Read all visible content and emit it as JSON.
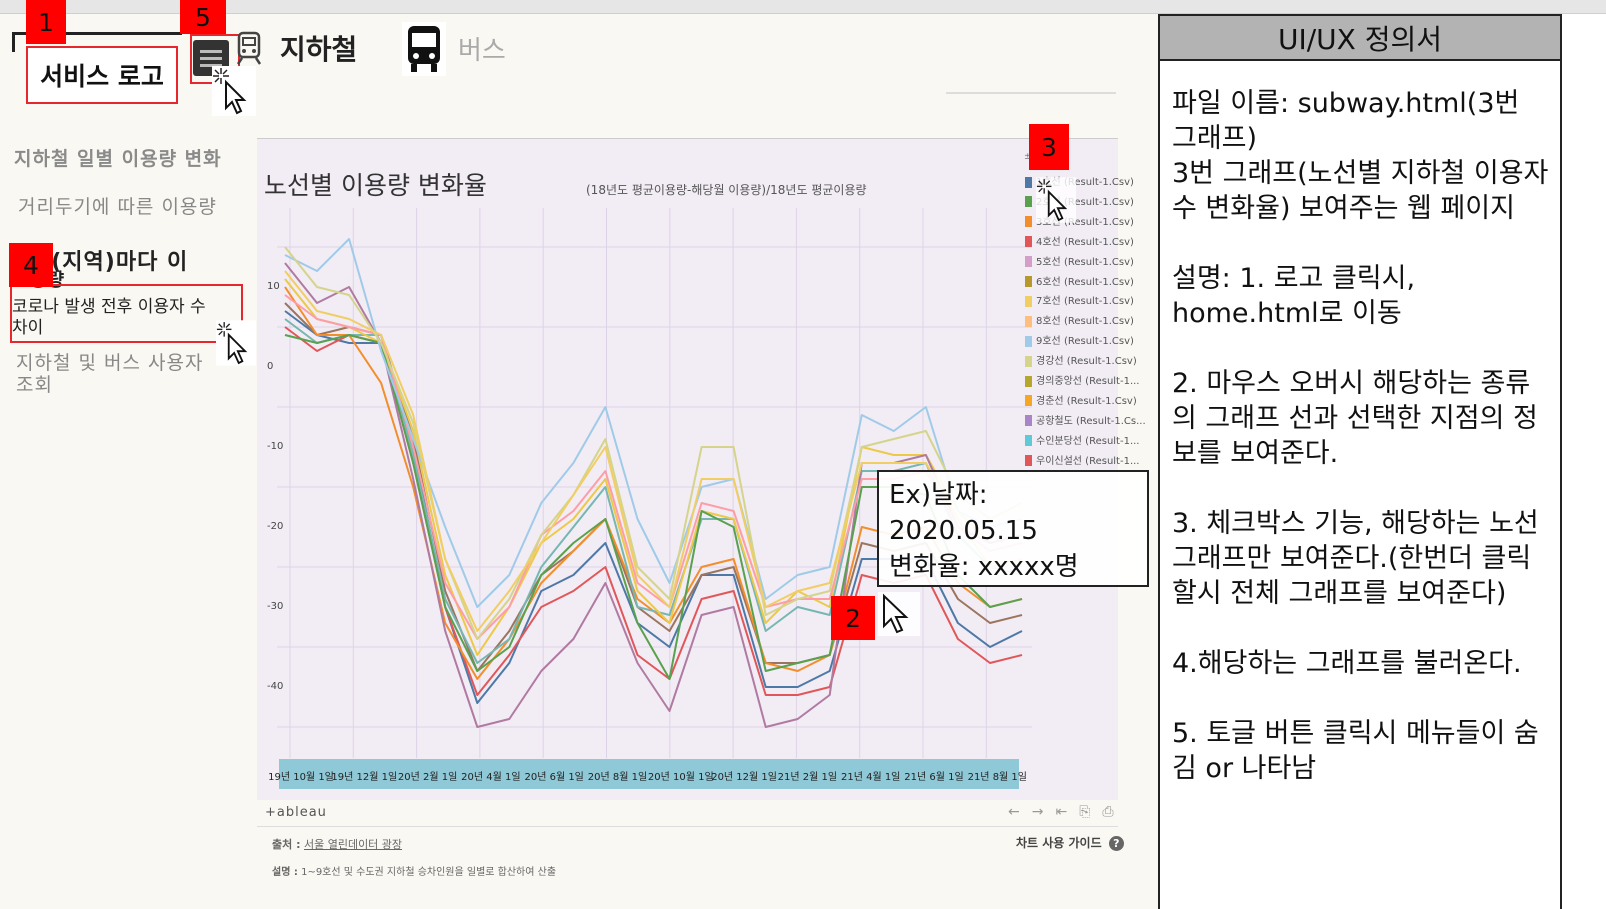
{
  "nav": {
    "logo": "서비스 로고",
    "subway_tab": "지하철",
    "bus_tab": "버스"
  },
  "sidebar": {
    "items": [
      {
        "label": "지하철 일별 이용량 변화"
      },
      {
        "label": "거리두기에 따른 이용량"
      },
      {
        "label": "선(지역)마다 이"
      },
      {
        "label": "코로나 발생 전후 이용자 수 차이"
      },
      {
        "label": "지하철 및 버스 사용자 조회"
      }
    ],
    "overlap_fragment": "용량"
  },
  "markers": [
    "1",
    "2",
    "3",
    "4",
    "5"
  ],
  "chart_data": {
    "type": "line",
    "title": "노선별 이용량 변화율",
    "subtitle": "(18년도 평균이용량-해당월 이용량)/18년도 평균이용량",
    "x_ticks": [
      "19년 10월 1일",
      "19년 12월 1일",
      "20년 2월 1일",
      "20년 4월 1일",
      "20년 6월 1일",
      "20년 8월 1일",
      "20년 10월 1일",
      "20년 12월 1일",
      "21년 2월 1일",
      "21년 4월 1일",
      "21년 6월 1일",
      "21년 8월 1일"
    ],
    "y_ticks": [
      "10",
      "0",
      "-10",
      "-20",
      "-30",
      "-40"
    ],
    "ylim": [
      -50,
      15
    ],
    "x_points": 24,
    "series": [
      {
        "color": "#4e79a7",
        "values": [
          7,
          4,
          3,
          3,
          -10,
          -30,
          -42,
          -37,
          -28,
          -26,
          -22,
          -32,
          -35,
          -26,
          -26,
          -40,
          -40,
          -38,
          -24,
          -24,
          -24,
          -32,
          -35,
          -33
        ]
      },
      {
        "color": "#e15759",
        "values": [
          5,
          2,
          4,
          3,
          -12,
          -30,
          -41,
          -36,
          -30,
          -28,
          -25,
          -36,
          -39,
          -29,
          -28,
          -41,
          -41,
          -40,
          -26,
          -27,
          -26,
          -34,
          -37,
          -36
        ]
      },
      {
        "color": "#9c755f",
        "values": [
          8,
          4,
          5,
          4,
          -9,
          -28,
          -38,
          -33,
          -26,
          -23,
          -19,
          -30,
          -33,
          -26,
          -25,
          -37,
          -37,
          -36,
          -22,
          -23,
          -22,
          -29,
          -32,
          -31
        ]
      },
      {
        "color": "#f28e2b",
        "values": [
          10,
          4,
          4,
          -2,
          -15,
          -32,
          -39,
          -34,
          -27,
          -23,
          -19,
          -29,
          -32,
          -25,
          -24,
          -37,
          -38,
          -36,
          -20,
          -21,
          -20,
          -27,
          -30,
          -29
        ]
      },
      {
        "color": "#76b7b2",
        "values": [
          6,
          3,
          4,
          4,
          -11,
          -29,
          -37,
          -34,
          -25,
          -20,
          -15,
          -30,
          -31,
          -19,
          -19,
          -33,
          -30,
          -31,
          -13,
          -13,
          -12,
          -21,
          -25,
          -26
        ]
      },
      {
        "color": "#edc948",
        "values": [
          11,
          6,
          5,
          3,
          -8,
          -26,
          -36,
          -30,
          -22,
          -19,
          -14,
          -28,
          -32,
          -18,
          -19,
          -32,
          -28,
          -30,
          -10,
          -11,
          -11,
          -18,
          -22,
          -21
        ]
      },
      {
        "color": "#b07aa1",
        "values": [
          13,
          8,
          10,
          3,
          -14,
          -33,
          -45,
          -44,
          -38,
          -34,
          -27,
          -37,
          -43,
          -31,
          -30,
          -45,
          -44,
          -41,
          -12,
          -12,
          -11,
          -20,
          -22,
          -21
        ]
      },
      {
        "color": "#ff9da7",
        "values": [
          9,
          6,
          5,
          4,
          -10,
          -27,
          -34,
          -30,
          -21,
          -18,
          -13,
          -27,
          -30,
          -17,
          -18,
          -30,
          -29,
          -29,
          -14,
          -14,
          -13,
          -20,
          -23,
          -22
        ]
      },
      {
        "color": "#59a14f",
        "values": [
          4,
          3,
          4,
          3,
          -12,
          -30,
          -38,
          -35,
          -26,
          -22,
          -19,
          -32,
          -39,
          -18,
          -20,
          -38,
          -37,
          -36,
          -15,
          -15,
          -16,
          -26,
          -30,
          -29
        ]
      },
      {
        "color": "#a0cbe8",
        "values": [
          14,
          12,
          16,
          2,
          -9,
          -20,
          -30,
          -26,
          -17,
          -12,
          -5,
          -19,
          -27,
          -15,
          -14,
          -29,
          -26,
          -25,
          -6,
          -8,
          -5,
          -18,
          -20,
          -19
        ]
      },
      {
        "color": "#d4d48a",
        "values": [
          15,
          10,
          9,
          3,
          -7,
          -24,
          -34,
          -29,
          -21,
          -16,
          -9,
          -25,
          -29,
          -10,
          -10,
          -31,
          -29,
          -28,
          -10,
          -9,
          -8,
          -16,
          -19,
          -17
        ]
      },
      {
        "color": "#f1ce63",
        "values": [
          12,
          7,
          6,
          4,
          -6,
          -24,
          -33,
          -28,
          -22,
          -16,
          -10,
          -26,
          -30,
          -14,
          -14,
          -30,
          -28,
          -27,
          -12,
          -12,
          -12,
          -19,
          -25,
          -24
        ]
      }
    ],
    "legend": [
      {
        "label": "1호선 (Result-1.Csv)",
        "color": "#4e79a7"
      },
      {
        "label": "2호선 (Result-1.Csv)",
        "color": "#59a14f"
      },
      {
        "label": "3호선 (Result-1.Csv)",
        "color": "#f28e2b"
      },
      {
        "label": "4호선 (Result-1.Csv)",
        "color": "#e15759"
      },
      {
        "label": "5호선 (Result-1.Csv)",
        "color": "#d39fc9"
      },
      {
        "label": "6호선 (Result-1.Csv)",
        "color": "#b6992d"
      },
      {
        "label": "7호선 (Result-1.Csv)",
        "color": "#f1ce63"
      },
      {
        "label": "8호선 (Result-1.Csv)",
        "color": "#ffbe7d"
      },
      {
        "label": "9호선 (Result-1.Csv)",
        "color": "#a0cbe8"
      },
      {
        "label": "경강선 (Result-1.Csv)",
        "color": "#d4d48a"
      },
      {
        "label": "경의중앙선 (Result-1...",
        "color": "#b5a62e"
      },
      {
        "label": "경춘선 (Result-1.Csv)",
        "color": "#f5a623"
      },
      {
        "label": "공항철도 (Result-1.Cs...",
        "color": "#a985c8"
      },
      {
        "label": "수인분당선 (Result-1...",
        "color": "#5fc9d8"
      },
      {
        "label": "우이신설선 (Result-1...",
        "color": "#e15759"
      }
    ]
  },
  "tooltip": {
    "line1": "Ex)날짜:",
    "line2": "2020.05.15",
    "line3": "변화율: xxxxx명"
  },
  "footer": {
    "brand": "+ableau",
    "source_label": "출처 :",
    "source_link": "서울 열린데이터 광장",
    "desc_label": "설명 :",
    "desc": "1~9호선 및 수도권 지하철 승차인원을 일별로 합산하여 산출",
    "guide": "차트 사용 가이드",
    "guide_icon": "?"
  },
  "spec": {
    "title": "UI/UX 정의서",
    "body": "파일 이름: subway.html(3번 그래프)\n3번 그래프(노선별 지하철 이용자수 변화율) 보여주는 웹 페이지\n\n설명: 1. 로고 클릭시, home.html로 이동\n\n2. 마우스 오버시 해당하는 종류의 그래프 선과 선택한 지점의 정보를 보여준다.\n\n3. 체크박스 기능, 해당하는 노선 그래프만 보여준다.(한번더 클릭할시 전체 그래프를 보여준다)\n\n4.해당하는 그래프를 불러온다.\n\n5. 토글 버튼 클릭시 메뉴들이 숨김 or 나타남"
  }
}
